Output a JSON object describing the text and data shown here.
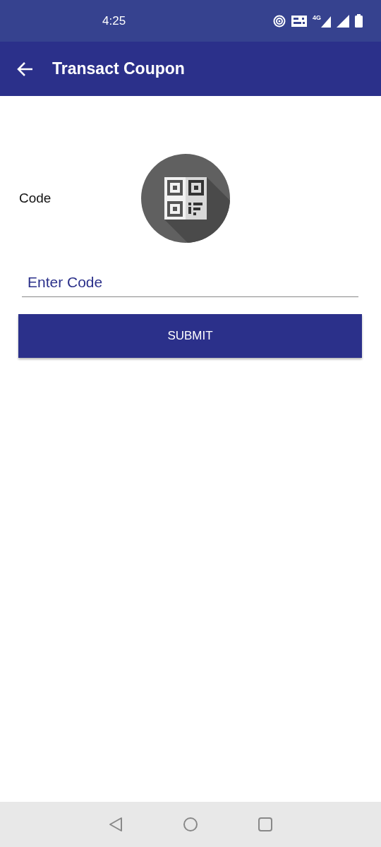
{
  "status_bar": {
    "time": "4:25",
    "network": "4G"
  },
  "app_bar": {
    "title": "Transact Coupon"
  },
  "form": {
    "label": "Code",
    "field": {
      "placeholder": "Enter Code"
    },
    "submit": "SUBMIT"
  }
}
